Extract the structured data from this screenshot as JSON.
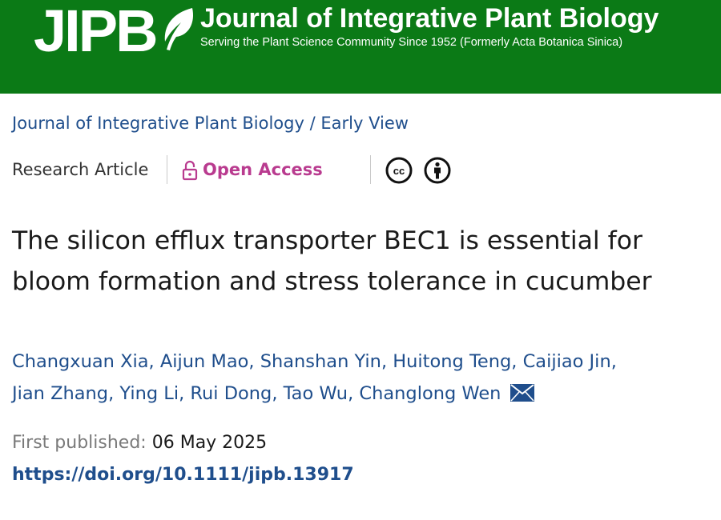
{
  "banner": {
    "logo_text": "JIPB",
    "title": "Journal of Integrative Plant Biology",
    "subtitle": "Serving the Plant Science Community Since 1952 (Formerly Acta Botanica Sinica)",
    "background_color": "#0b7a16",
    "logo_icon": "leaf-icon"
  },
  "breadcrumb": {
    "journal": "Journal of Integrative Plant Biology",
    "separator": "/",
    "section": "Early View"
  },
  "meta": {
    "article_type": "Research Article",
    "open_access_label": "Open Access",
    "open_access_icon": "lock-open-icon",
    "open_access_color": "#b93b8f",
    "license_icons": [
      "cc-icon",
      "by-attribution-icon"
    ]
  },
  "article": {
    "title": "The silicon efflux transporter BEC1 is essential for bloom formation and stress tolerance in cucumber"
  },
  "authors": [
    {
      "name": "Changxuan Xia"
    },
    {
      "name": "Aijun Mao"
    },
    {
      "name": "Shanshan Yin"
    },
    {
      "name": "Huitong Teng"
    },
    {
      "name": "Caijiao Jin"
    },
    {
      "name": "Jian Zhang"
    },
    {
      "name": "Ying Li"
    },
    {
      "name": "Rui Dong"
    },
    {
      "name": "Tao Wu"
    },
    {
      "name": "Changlong Wen",
      "corresponding": true
    }
  ],
  "author_separator": ",",
  "publication": {
    "first_published_label": "First published:",
    "first_published_date": "06 May 2025",
    "doi": "https://doi.org/10.1111/jipb.13917"
  },
  "colors": {
    "link_blue": "#1f4e8c",
    "text_dark": "#1a1a1a",
    "text_muted": "#7a7a7a"
  }
}
